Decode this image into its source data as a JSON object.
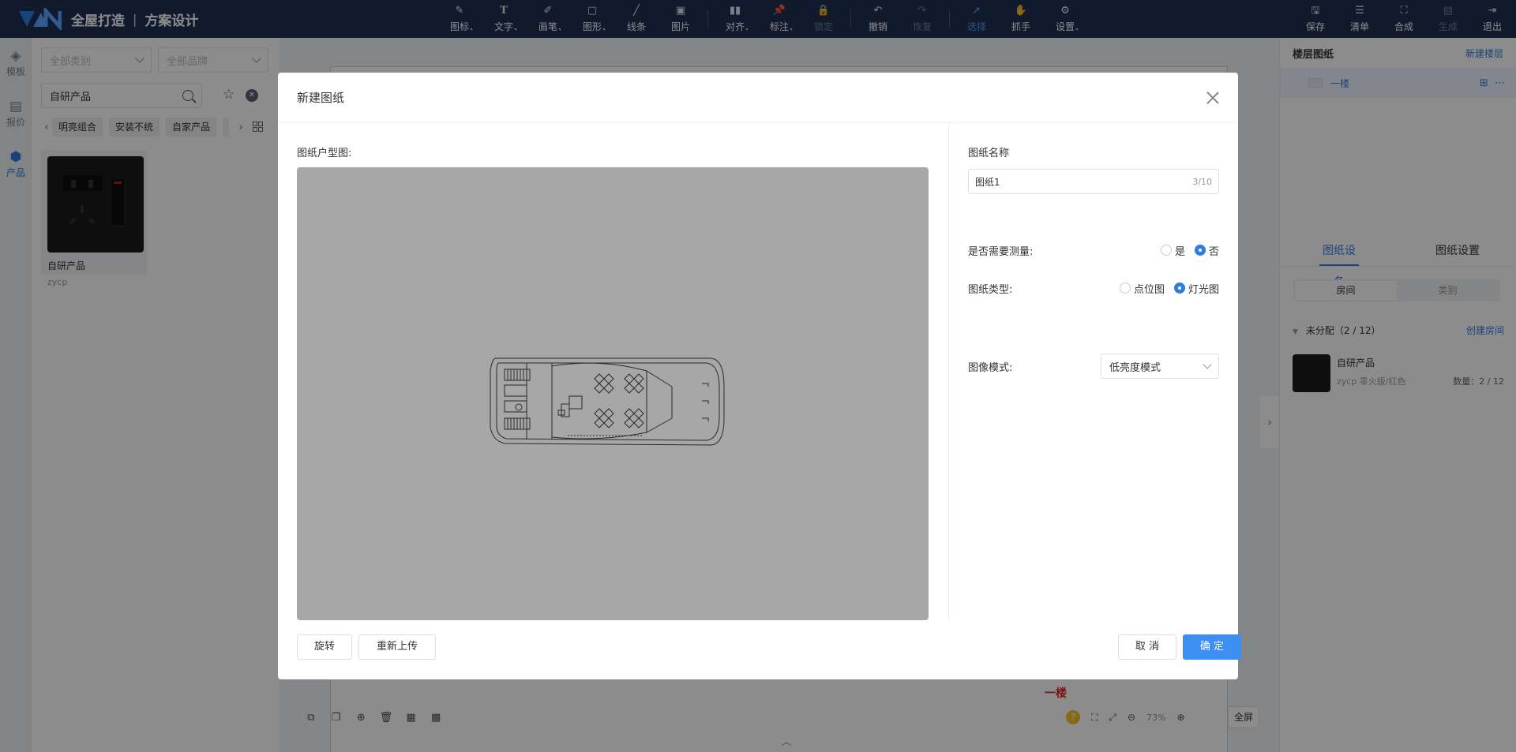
{
  "app": {
    "brand": "全屋打造",
    "separator": "|",
    "module": "方案设计"
  },
  "toolbar": {
    "tools": [
      {
        "label": "图标",
        "icon": "icon-tool-icon",
        "dropdown": true
      },
      {
        "label": "文字",
        "icon": "text-icon",
        "dropdown": true
      },
      {
        "label": "画笔",
        "icon": "brush-icon",
        "dropdown": true
      },
      {
        "label": "图形",
        "icon": "shape-icon",
        "dropdown": true
      },
      {
        "label": "线条",
        "icon": "line-icon",
        "dropdown": false
      },
      {
        "label": "图片",
        "icon": "image-icon",
        "dropdown": false
      },
      {
        "label": "对齐",
        "icon": "align-icon",
        "dropdown": true
      },
      {
        "label": "标注",
        "icon": "pin-icon",
        "dropdown": true
      },
      {
        "label": "锁定",
        "icon": "lock-icon",
        "disabled": true
      },
      {
        "label": "撤销",
        "icon": "undo-icon"
      },
      {
        "label": "恢复",
        "icon": "redo-icon",
        "disabled": true
      },
      {
        "label": "选择",
        "icon": "cursor-icon",
        "active": true
      },
      {
        "label": "抓手",
        "icon": "hand-icon"
      },
      {
        "label": "设置",
        "icon": "gear-icon",
        "dropdown": true
      }
    ],
    "right": [
      {
        "label": "保存",
        "icon": "save-icon"
      },
      {
        "label": "清单",
        "icon": "list-icon"
      },
      {
        "label": "合成",
        "icon": "merge-icon"
      },
      {
        "label": "生成",
        "icon": "generate-icon",
        "disabled": true
      },
      {
        "label": "退出",
        "icon": "exit-icon"
      }
    ]
  },
  "leftrail": [
    {
      "label": "模板",
      "icon": "layers-icon"
    },
    {
      "label": "报价",
      "icon": "quote-icon"
    },
    {
      "label": "产品",
      "icon": "cube-icon",
      "active": true
    }
  ],
  "products": {
    "category_placeholder": "全部类别",
    "brand_placeholder": "全部品牌",
    "search_value": "自研产品",
    "chips": [
      "明亮组合",
      "安装不统",
      "自家产品"
    ],
    "card": {
      "name": "自研产品",
      "code": "zycp"
    }
  },
  "rightpanel": {
    "title": "楼层图纸",
    "new_floor": "新建楼层",
    "floor": "一楼",
    "tabs": [
      "图纸设备",
      "图纸设置"
    ],
    "segments": [
      "房间",
      "类别"
    ],
    "unassigned": "未分配（2 / 12）",
    "create_room": "创建房间",
    "item": {
      "name": "自研产品",
      "spec": "zycp 零火版/红色",
      "qty": "数量：2 / 12"
    }
  },
  "canvas": {
    "floor_label": "一楼",
    "zoom": "73%",
    "fullscreen": "全屏",
    "help": "?"
  },
  "modal": {
    "title": "新建图纸",
    "plan_label": "图纸户型图:",
    "name_label": "图纸名称",
    "name_value": "图纸1",
    "name_count": "3/10",
    "measure_label": "是否需要测量:",
    "measure_options": [
      "是",
      "否"
    ],
    "measure_selected": "否",
    "type_label": "图纸类型:",
    "type_options": [
      "点位图",
      "灯光图"
    ],
    "type_selected": "灯光图",
    "mode_label": "图像模式:",
    "mode_value": "低亮度模式",
    "rotate": "旋转",
    "reupload": "重新上传",
    "cancel": "取 消",
    "confirm": "确 定"
  },
  "colors": {
    "topbar": "#1f3052",
    "accent": "#2f7de1",
    "primary_button": "#3c8ef0",
    "floor_label": "#e02020"
  }
}
